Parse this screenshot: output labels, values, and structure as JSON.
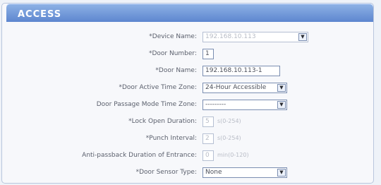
{
  "header": {
    "title": "ACCESS"
  },
  "form": {
    "rows": [
      {
        "label": "Device Name:",
        "value": "192.168.10.113",
        "disabled": true,
        "type": "select"
      },
      {
        "label": "Door Number:",
        "value": "1",
        "disabled": false,
        "type": "input"
      },
      {
        "label": "Door Name:",
        "value": "192.168.10.113-1",
        "disabled": false,
        "type": "input"
      },
      {
        "label": "Door Active Time Zone:",
        "value": "24-Hour Accessible",
        "disabled": false,
        "type": "select"
      },
      {
        "label": "Door Passage Mode Time Zone:",
        "value": "---------",
        "disabled": false,
        "type": "select"
      },
      {
        "label": "Lock Open Duration:",
        "value": "5",
        "hint": "s(0-254)",
        "disabled": true,
        "type": "input"
      },
      {
        "label": "Punch Interval:",
        "value": "2",
        "hint": "s(0-254)",
        "disabled": true,
        "type": "input"
      },
      {
        "label": "Anti-passback Duration of Entrance:",
        "value": "0",
        "hint": "min(0-120)",
        "disabled": true,
        "type": "input"
      },
      {
        "label": "Door Sensor Type:",
        "value": "None",
        "disabled": false,
        "type": "select"
      }
    ]
  }
}
